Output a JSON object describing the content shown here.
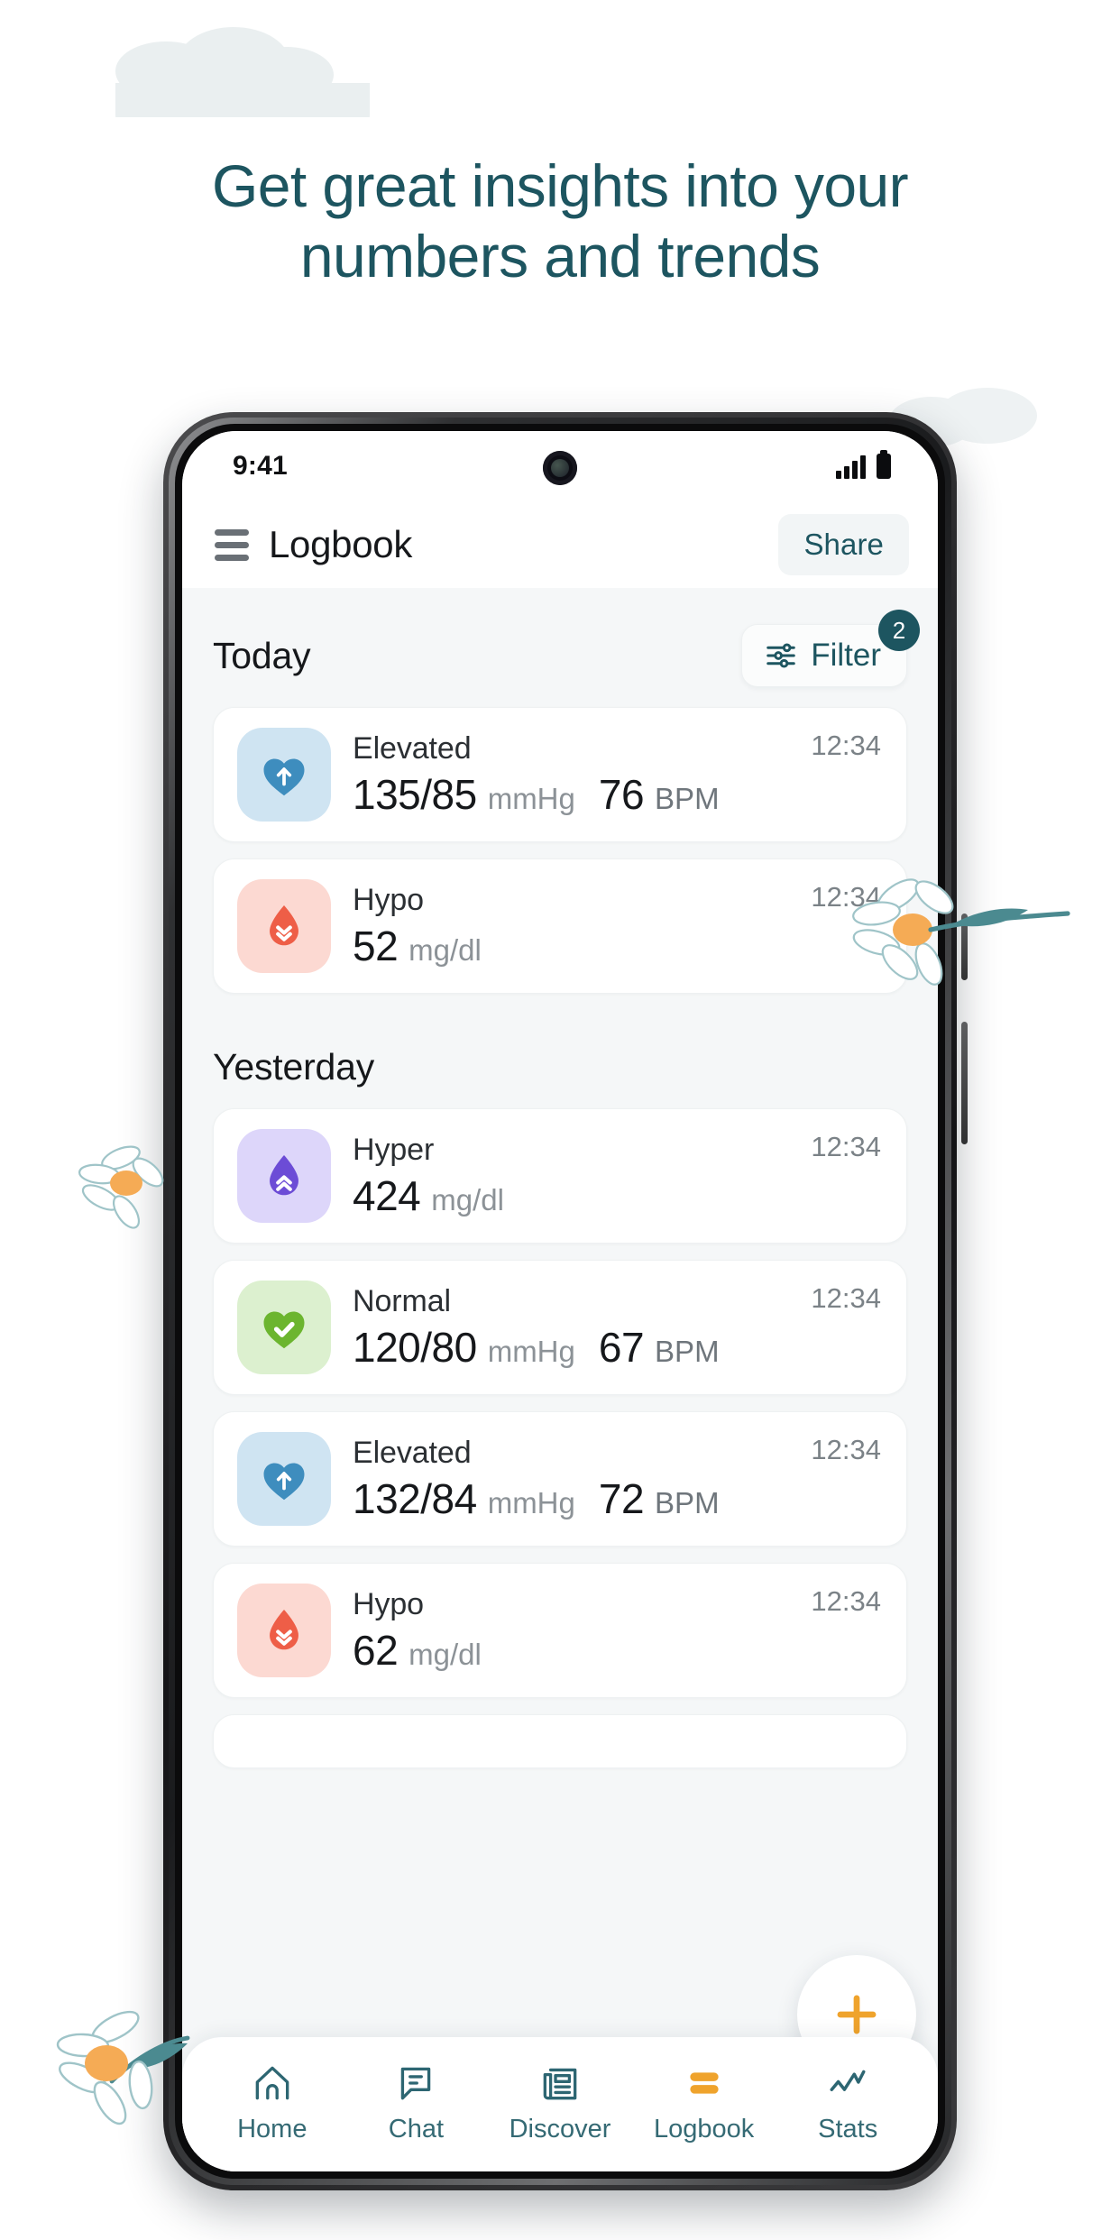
{
  "promo": {
    "headline_line1": "Get great insights into your",
    "headline_line2": "numbers and trends",
    "headline_color": "#1d5560"
  },
  "status_bar": {
    "time": "9:41",
    "signal_icon": "signal-bars-icon",
    "battery_icon": "battery-full-icon",
    "camera_icon": "front-camera-punch-hole"
  },
  "app_header": {
    "menu_icon": "hamburger-menu-icon",
    "title": "Logbook",
    "share_label": "Share"
  },
  "toolbar": {
    "filter_label": "Filter",
    "filter_icon": "sliders-icon",
    "filter_badge_count": "2",
    "badge_color": "#1d5560"
  },
  "sections": [
    {
      "title": "Today",
      "entries": [
        {
          "label": "Elevated",
          "kind": "blood-pressure",
          "icon": "heart-arrow-up-icon",
          "tile_bg": "#cfe4f2",
          "icon_color": "#3e8dbe",
          "primary": "135/85",
          "unit": "mmHg",
          "secondary": "76",
          "secondary_unit": "BPM",
          "time": "12:34"
        },
        {
          "label": "Hypo",
          "kind": "glucose",
          "icon": "blood-drop-chevrons-down-icon",
          "tile_bg": "#fcd9d2",
          "icon_color": "#ee5e47",
          "primary": "52",
          "unit": "mg/dl",
          "secondary": "",
          "secondary_unit": "",
          "time": "12:34"
        }
      ]
    },
    {
      "title": "Yesterday",
      "entries": [
        {
          "label": "Hyper",
          "kind": "glucose",
          "icon": "blood-drop-chevrons-up-icon",
          "tile_bg": "#ddd6fa",
          "icon_color": "#6c4cd6",
          "primary": "424",
          "unit": "mg/dl",
          "secondary": "",
          "secondary_unit": "",
          "time": "12:34"
        },
        {
          "label": "Normal",
          "kind": "blood-pressure",
          "icon": "heart-check-icon",
          "tile_bg": "#dcf0cf",
          "icon_color": "#6cb52f",
          "primary": "120/80",
          "unit": "mmHg",
          "secondary": "67",
          "secondary_unit": "BPM",
          "time": "12:34"
        },
        {
          "label": "Elevated",
          "kind": "blood-pressure",
          "icon": "heart-arrow-up-icon",
          "tile_bg": "#cfe4f2",
          "icon_color": "#3e8dbe",
          "primary": "132/84",
          "unit": "mmHg",
          "secondary": "72",
          "secondary_unit": "BPM",
          "time": "12:34"
        },
        {
          "label": "Hypo",
          "kind": "glucose",
          "icon": "blood-drop-chevrons-down-icon",
          "tile_bg": "#fcd9d2",
          "icon_color": "#ee5e47",
          "primary": "62",
          "unit": "mg/dl",
          "secondary": "",
          "secondary_unit": "",
          "time": "12:34"
        }
      ]
    }
  ],
  "fab": {
    "icon": "plus-icon",
    "color": "#efa32c"
  },
  "bottom_nav": {
    "active": "Logbook",
    "items": [
      {
        "label": "Home",
        "icon": "home-icon"
      },
      {
        "label": "Chat",
        "icon": "chat-bubble-icon"
      },
      {
        "label": "Discover",
        "icon": "newspaper-icon"
      },
      {
        "label": "Logbook",
        "icon": "logbook-bars-icon"
      },
      {
        "label": "Stats",
        "icon": "line-chart-icon"
      }
    ],
    "active_color": "#efa32c",
    "inactive_color": "#2d6672"
  }
}
